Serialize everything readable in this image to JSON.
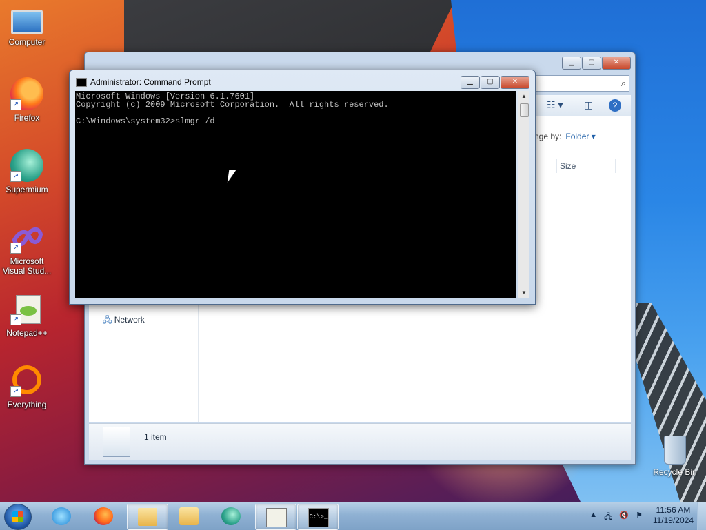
{
  "desktop": {
    "icons": [
      {
        "label": "Computer",
        "icon": "computer-icon"
      },
      {
        "label": "Firefox",
        "icon": "firefox-icon"
      },
      {
        "label": "Supermium",
        "icon": "supermium-icon"
      },
      {
        "label": "Microsoft Visual Stud...",
        "icon": "visual-studio-icon"
      },
      {
        "label": "Notepad++",
        "icon": "notepad-plus-plus-icon"
      },
      {
        "label": "Everything",
        "icon": "everything-search-icon"
      }
    ],
    "recycle_bin": "Recycle Bin"
  },
  "explorer": {
    "nav_network": "Network",
    "arrange_by_label": "nge by:",
    "arrange_by_value": "Folder",
    "column_size": "Size",
    "status_count": "1 item"
  },
  "cmd": {
    "title": "Administrator:  Command Prompt",
    "lines": [
      "Microsoft Windows [Version 6.1.7601]",
      "Copyright (c) 2009 Microsoft Corporation.  All rights reserved.",
      "",
      "C:\\Windows\\system32>slmgr /d"
    ]
  },
  "taskbar": {
    "clock_time": "11:56 AM",
    "clock_date": "11/19/2024",
    "cmd_glyph": "C:\\>_",
    "apps": [
      {
        "icon": "internet-explorer-icon"
      },
      {
        "icon": "firefox-icon"
      },
      {
        "icon": "file-explorer-icon",
        "active": true
      },
      {
        "icon": "media-player-icon"
      },
      {
        "icon": "supermium-icon"
      },
      {
        "icon": "notepad-plus-plus-icon",
        "active": true
      },
      {
        "icon": "command-prompt-icon",
        "active": true
      }
    ]
  }
}
